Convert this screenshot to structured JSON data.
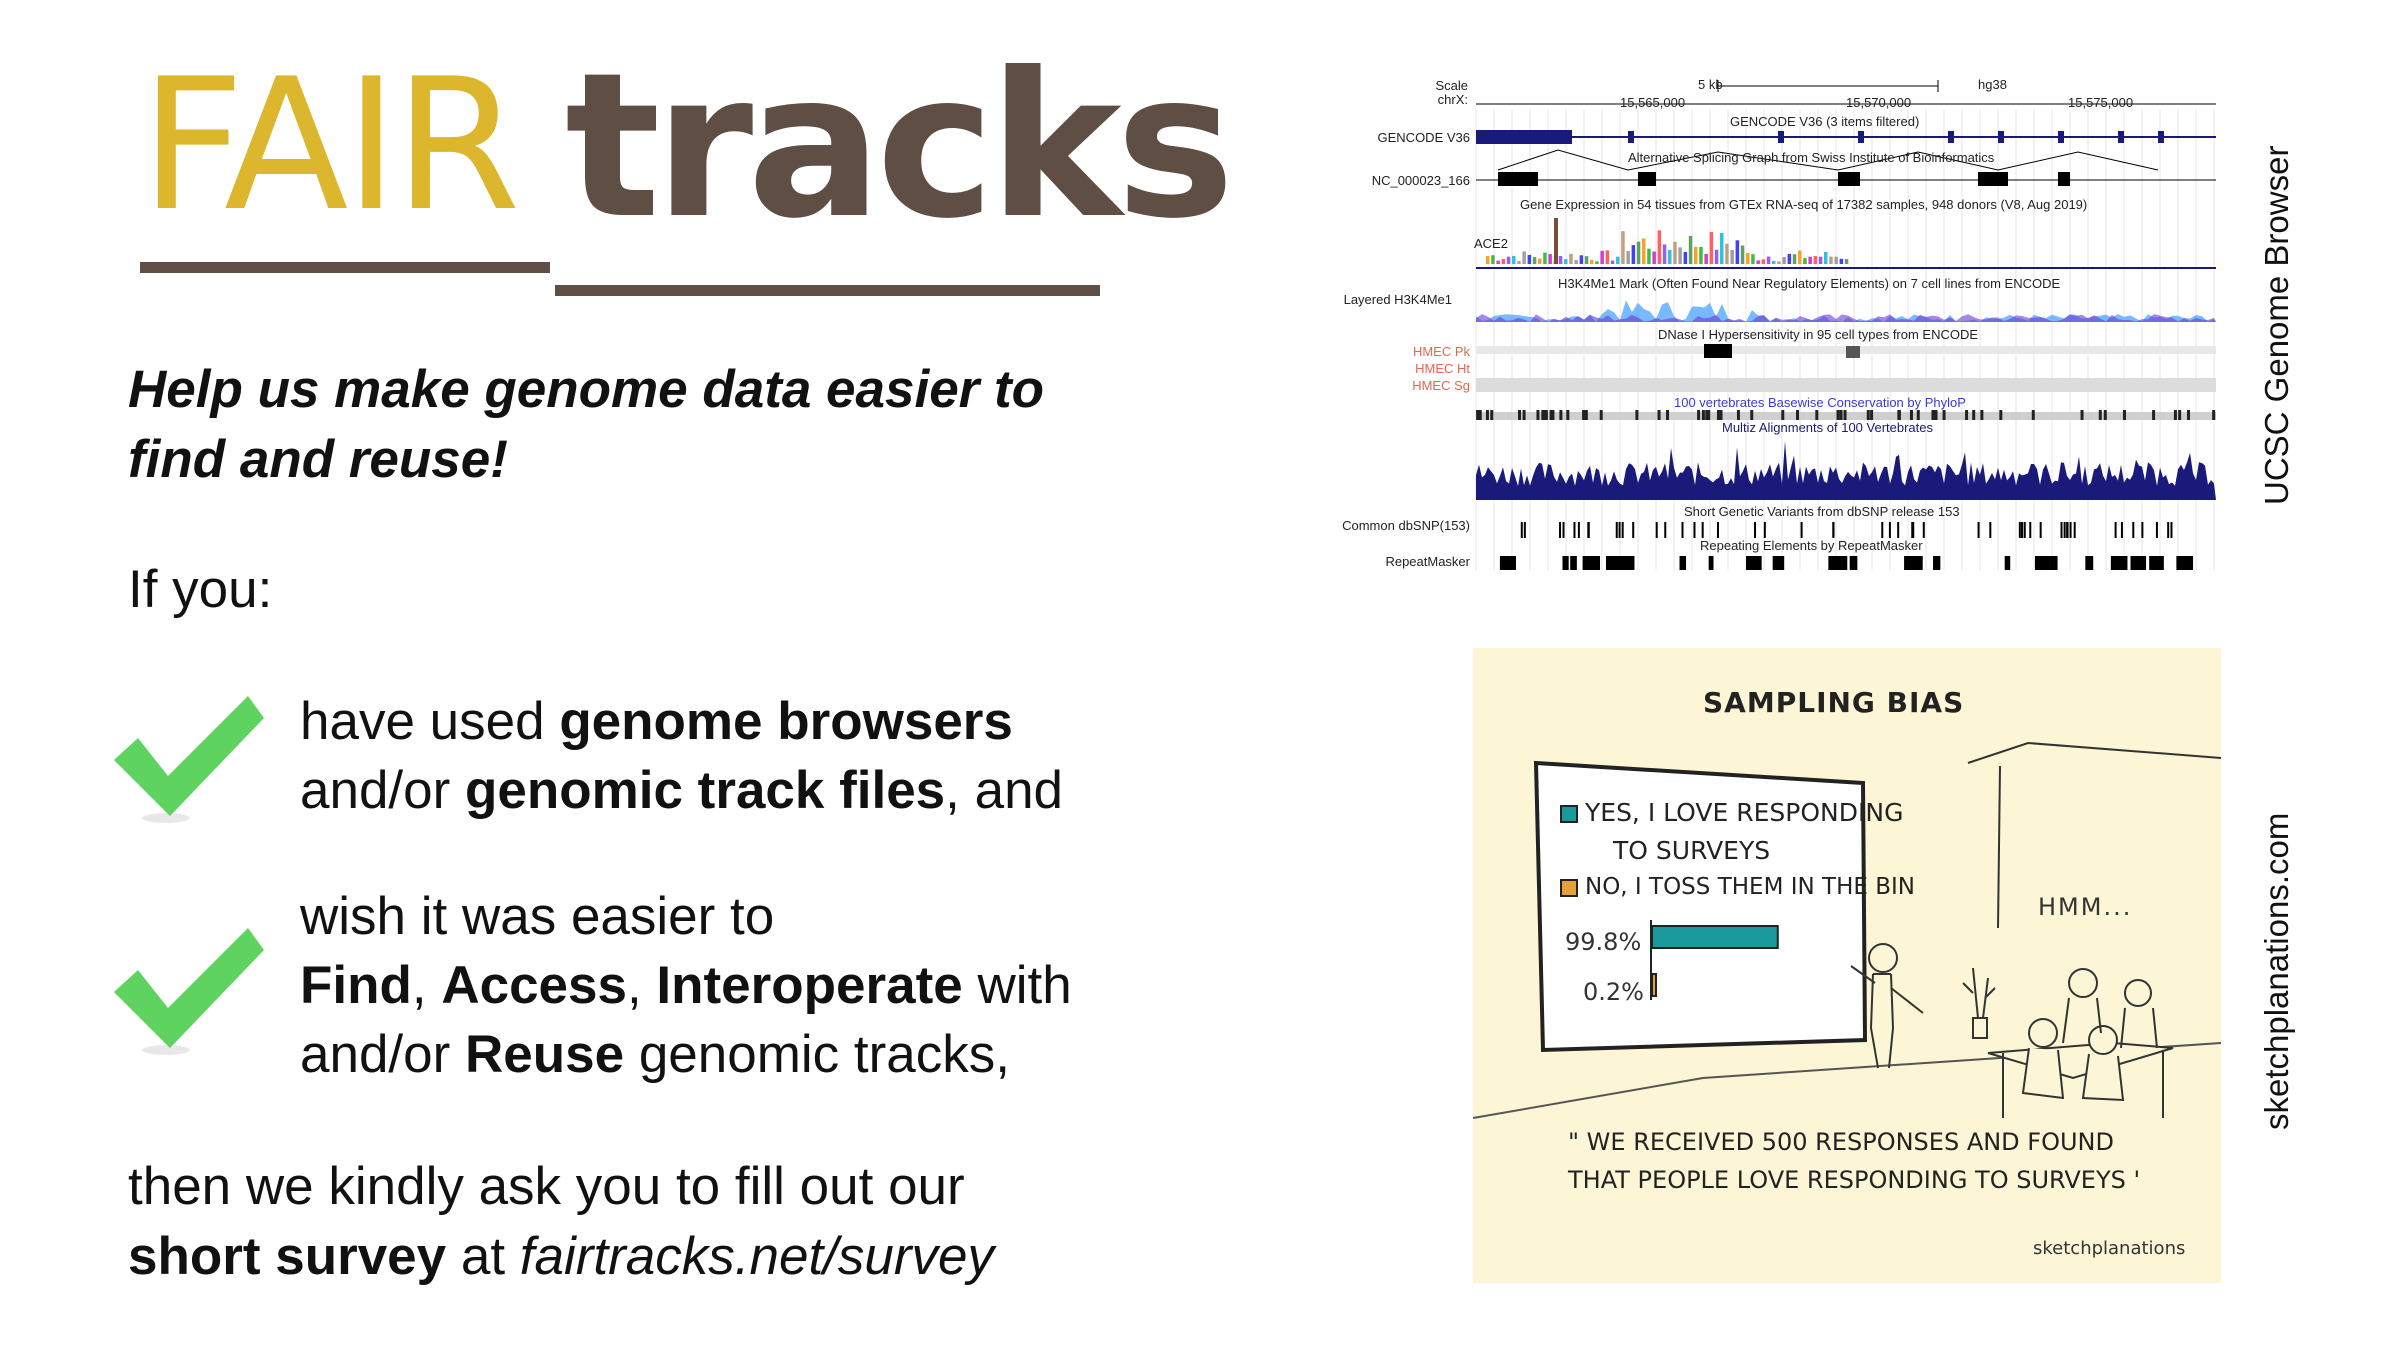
{
  "logo": {
    "fair": "FAIR",
    "tracks": "tracks"
  },
  "headline_line1": "Help us make genome data easier to",
  "headline_line2": "find and reuse!",
  "if_you": "If you:",
  "item1": {
    "p1": "have used ",
    "b1": "genome browsers",
    "p2": "and/or ",
    "b2": "genomic track files",
    "p3": ", and"
  },
  "item2": {
    "p1": "wish it was easier to",
    "b1": "Find",
    "s1": ", ",
    "b2": "Access",
    "s2": ", ",
    "b3": "Interoperate",
    "s3": " with",
    "p2": "and/or ",
    "b4": "Reuse",
    "p3": " genomic tracks,"
  },
  "closing": {
    "line1": "then we kindly ask you to fill out our",
    "bold": "short survey",
    "mid": " at ",
    "link": "fairtracks.net/survey"
  },
  "captions": {
    "genome_browser": "UCSC Genome Browser",
    "sketch": "sketchplanations.com"
  },
  "genome_browser": {
    "scale_label": "Scale",
    "chr_label": "chrX:",
    "scale_value": "5 kb",
    "assembly": "hg38",
    "positions": [
      "15,565,000",
      "15,570,000",
      "15,575,000"
    ],
    "track_labels": [
      "GENCODE V36",
      "NC_000023_166",
      "ACE2",
      "Layered H3K4Me1",
      "HMEC Pk",
      "HMEC Ht",
      "HMEC Sg",
      "Common dbSNP(153)",
      "RepeatMasker"
    ],
    "track_titles": [
      "GENCODE V36 (3 items filtered)",
      "Alternative Splicing Graph from Swiss Institute of Bioinformatics",
      "Gene Expression in 54 tissues from GTEx RNA-seq of 17382 samples, 948 donors (V8, Aug 2019)",
      "H3K4Me1 Mark (Often Found Near Regulatory Elements) on 7 cell lines from ENCODE",
      "DNase I Hypersensitivity in 95 cell types from ENCODE",
      "100 vertebrates Basewise Conservation by PhyloP",
      "Multiz Alignments of 100 Vertebrates",
      "Short Genetic Variants from dbSNP release 153",
      "Repeating Elements by RepeatMasker"
    ],
    "colors": {
      "navy": "#1a1a7a",
      "hmec": "#e2684e",
      "blue": "#3a3ad0"
    }
  },
  "sketch": {
    "title": "SAMPLING BIAS",
    "yes": "YES, I LOVE RESPONDING",
    "yes2": "TO SURVEYS",
    "no": "NO, I TOSS THEM IN THE BIN",
    "pct_yes": "99.8%",
    "pct_no": "0.2%",
    "hmm": "HMM...",
    "quote": "\" WE RECEIVED 500 RESPONSES AND FOUND THAT PEOPLE LOVE RESPONDING TO SURVEYS '",
    "signature": "sketchplanations",
    "chart_values": {
      "yes": 99.8,
      "no": 0.2
    },
    "colors": {
      "yes": "#1a9a9a",
      "no": "#e6a23a",
      "paper": "#fcf5d6"
    }
  },
  "colors": {
    "fair": "#dcb62d",
    "tracks": "#5e4e44",
    "check": "#5fd35f"
  }
}
